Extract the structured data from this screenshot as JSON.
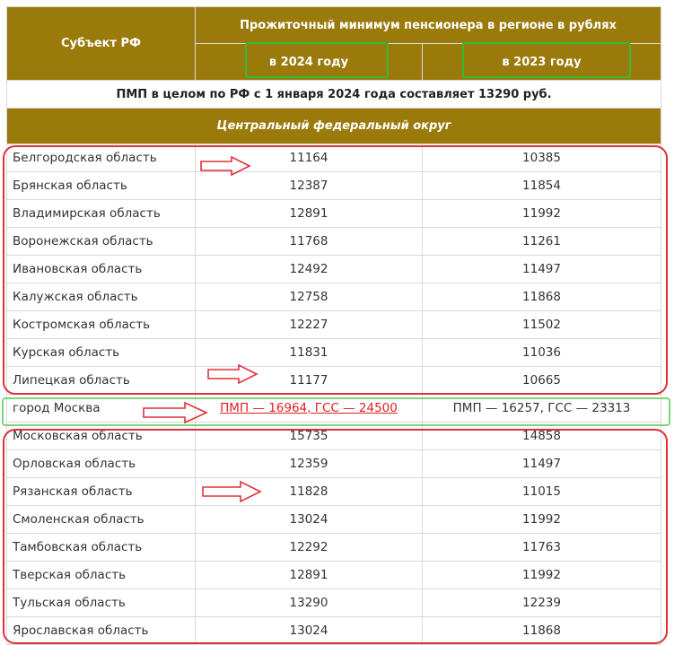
{
  "table": {
    "header": {
      "subject": "Субъект РФ",
      "group_title": "Прожиточный минимум пенсионера в регионе в рублях",
      "col_2024": "в 2024 году",
      "col_2023": "в 2023 году"
    },
    "note": "ПМП в целом по РФ с 1 января 2024 года составляет 13290 руб.",
    "district": "Центральный федеральный округ",
    "rows_a": [
      {
        "name": "Белгородская область",
        "v2024": "11164",
        "v2023": "10385"
      },
      {
        "name": "Брянская область",
        "v2024": "12387",
        "v2023": "11854"
      },
      {
        "name": "Владимирская область",
        "v2024": "12891",
        "v2023": "11992"
      },
      {
        "name": "Воронежская область",
        "v2024": "11768",
        "v2023": "11261"
      },
      {
        "name": "Ивановская область",
        "v2024": "12492",
        "v2023": "11497"
      },
      {
        "name": "Калужская область",
        "v2024": "12758",
        "v2023": "11868"
      },
      {
        "name": "Костромская область",
        "v2024": "12227",
        "v2023": "11502"
      },
      {
        "name": "Курская область",
        "v2024": "11831",
        "v2023": "11036"
      },
      {
        "name": "Липецкая область",
        "v2024": "11177",
        "v2023": "10665"
      }
    ],
    "moscow": {
      "name": "город Москва",
      "v2024": "ПМП — 16964, ГСС — 24500",
      "v2023": "ПМП — 16257, ГСС — 23313"
    },
    "rows_b": [
      {
        "name": "Московская область",
        "v2024": "15735",
        "v2023": "14858"
      },
      {
        "name": "Орловская область",
        "v2024": "12359",
        "v2023": "11497"
      },
      {
        "name": "Рязанская область",
        "v2024": "11828",
        "v2023": "11015"
      },
      {
        "name": "Смоленская область",
        "v2024": "13024",
        "v2023": "11992"
      },
      {
        "name": "Тамбовская область",
        "v2024": "12292",
        "v2023": "11763"
      },
      {
        "name": "Тверская область",
        "v2024": "12891",
        "v2023": "11992"
      },
      {
        "name": "Тульская область",
        "v2024": "13290",
        "v2023": "12239"
      },
      {
        "name": "Ярославская область",
        "v2024": "13024",
        "v2023": "11868"
      }
    ]
  },
  "colors": {
    "header_bg": "#9b7a0c",
    "link": "#e02020",
    "annotation_red": "#e0303a",
    "annotation_green": "#33bb33"
  }
}
